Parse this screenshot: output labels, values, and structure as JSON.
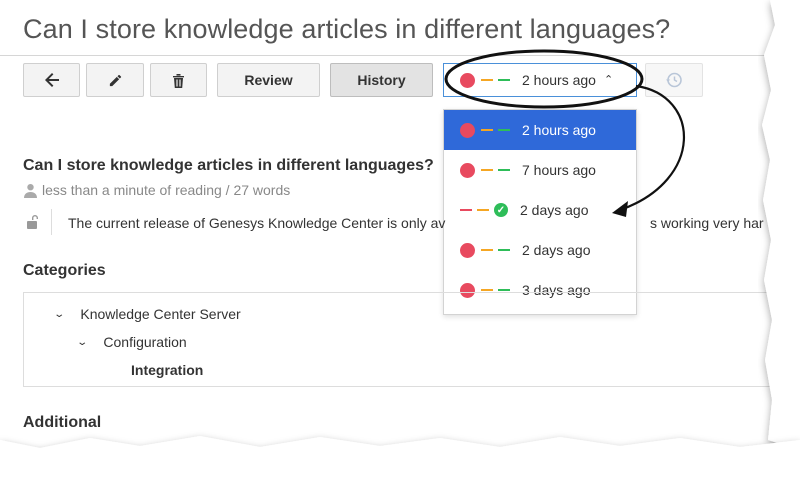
{
  "article": {
    "page_title": "Can I store knowledge articles in different languages?",
    "title": "Can I store knowledge articles in different languages?",
    "meta": "less than a minute of reading / 27 words",
    "body_start": "The current release of Genesys Knowledge Center is only av",
    "body_end": "s working very har"
  },
  "toolbar": {
    "review_label": "Review",
    "history_label": "History",
    "icons": [
      "back-arrow-icon",
      "pencil-icon",
      "trash-icon",
      "restore-history-icon"
    ]
  },
  "versions": {
    "selected": "2 hours ago",
    "items": [
      {
        "label": "2 hours ago",
        "status": "unpublished",
        "selected": true
      },
      {
        "label": "7 hours ago",
        "status": "unpublished"
      },
      {
        "label": "2 days ago",
        "status": "published"
      },
      {
        "label": "2 days ago",
        "status": "unpublished"
      },
      {
        "label": "3 days ago",
        "status": "unpublished"
      }
    ]
  },
  "categories": {
    "heading": "Categories",
    "items": [
      {
        "label": "Knowledge Center Server",
        "level": 0
      },
      {
        "label": "Configuration",
        "level": 1
      },
      {
        "label": "Integration",
        "level": 2
      }
    ]
  },
  "additional": {
    "heading": "Additional"
  },
  "colors": {
    "accent": "#2f69d9",
    "red": "#e84a5f",
    "orange": "#f5a623",
    "green": "#2ebd59"
  }
}
